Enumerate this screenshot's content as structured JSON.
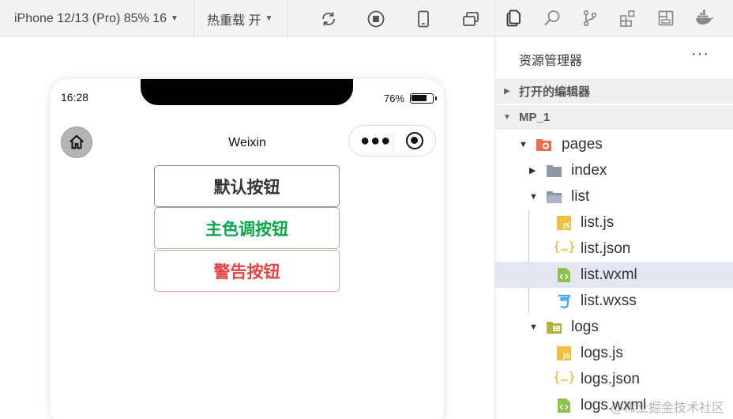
{
  "toolbar": {
    "device_label": "iPhone 12/13 (Pro) 85% 16",
    "hot_reload_label": "热重载 开"
  },
  "simulator": {
    "time": "16:28",
    "battery_pct": "76%",
    "battery_level": 0.76,
    "nav_title": "Weixin",
    "buttons": {
      "default_label": "默认按钮",
      "primary_label": "主色调按钮",
      "warn_label": "警告按钮"
    }
  },
  "explorer": {
    "title": "资源管理器",
    "more": "···",
    "open_editors": "打开的编辑器",
    "project": "MP_1",
    "tree": {
      "pages": "pages",
      "index": "index",
      "list": "list",
      "list_js": "list.js",
      "list_json": "list.json",
      "list_wxml": "list.wxml",
      "list_wxss": "list.wxss",
      "logs": "logs",
      "logs_js": "logs.js",
      "logs_json": "logs.json",
      "logs_wxml": "logs.wxml"
    }
  },
  "watermark": "@稀土掘金技术社区",
  "colors": {
    "primary_green": "#07a84a",
    "warn_red": "#e64340",
    "selected_row": "#e4e6f1",
    "js_yellow": "#f0c040",
    "wxml_green": "#8bc34a",
    "css_blue": "#42a5f5"
  }
}
